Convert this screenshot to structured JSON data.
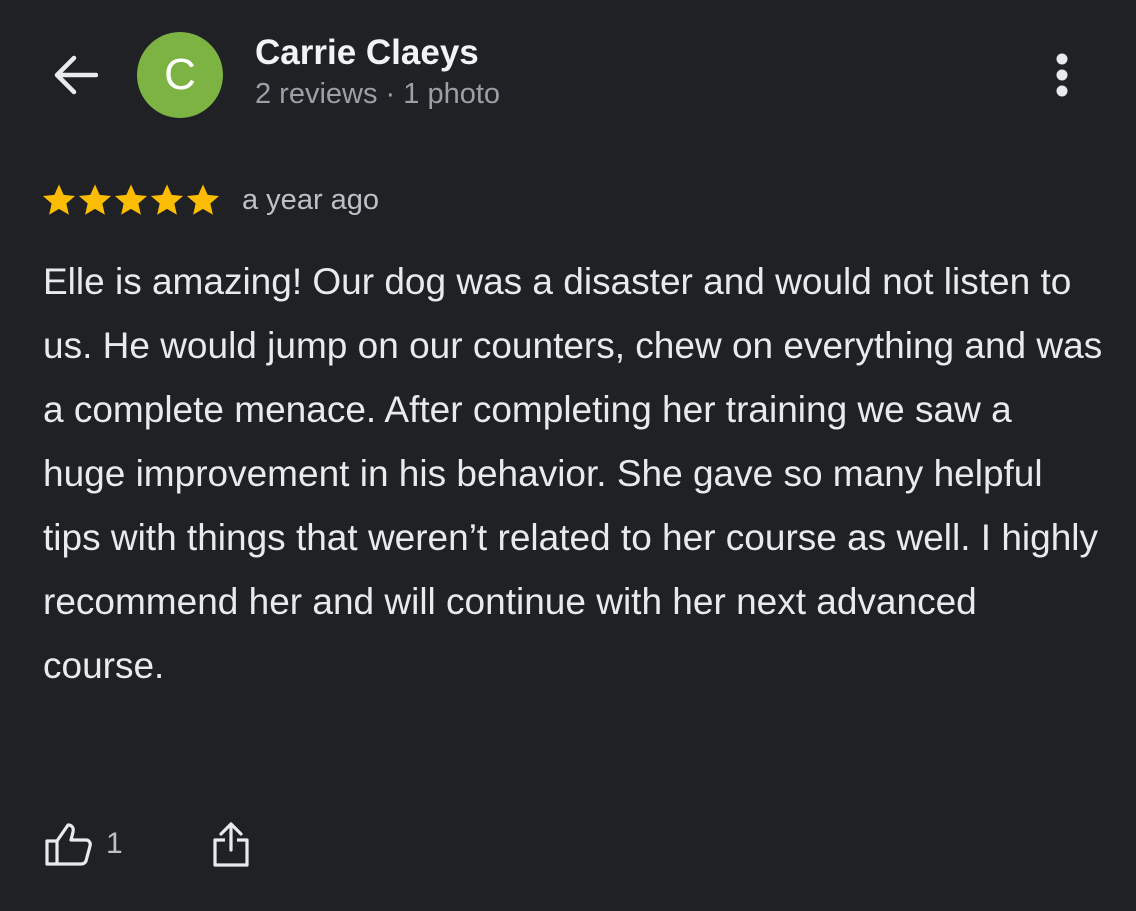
{
  "header": {
    "back_icon": "arrow-back-icon",
    "avatar": {
      "initial": "C",
      "color": "#7cb342"
    },
    "reviewer_name": "Carrie Claeys",
    "reviewer_meta": "2 reviews · 1 photo",
    "more_icon": "more-vert-icon"
  },
  "review": {
    "rating": 5,
    "max_rating": 5,
    "star_color": "#fbbc04",
    "time": "a year ago",
    "text": "Elle is amazing! Our dog was a disaster and would not listen to us. He would jump on our counters, chew on everything and was a complete menace. After completing her training we saw a huge improvement in his behavior. She gave so many helpful tips with things that weren’t related to her course as well. I highly recommend her and will continue with her next advanced course."
  },
  "actions": {
    "like_icon": "thumbs-up-icon",
    "like_count": "1",
    "share_icon": "share-icon"
  },
  "theme": {
    "background": "#202124",
    "text_primary": "#e8eaed",
    "text_secondary": "#9aa0a6"
  }
}
